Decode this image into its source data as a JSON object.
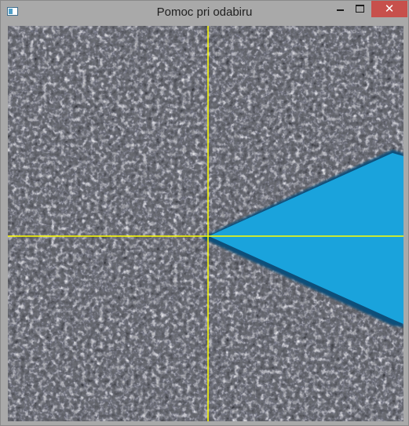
{
  "window": {
    "title": "Pomoc pri odabiru",
    "controls": {
      "minimize_icon": "minimize-icon",
      "maximize_icon": "maximize-icon",
      "close_icon": "close-icon",
      "close_glyph": "✕"
    }
  },
  "image_view": {
    "content": "zoomed gray asphalt texture with a blue triangular marker",
    "crosshair_color": "#ffff00",
    "marker_color": "#1aa3dc",
    "marker_shadow_color": "#0f4f7a",
    "background_color": "#6c6e74"
  }
}
